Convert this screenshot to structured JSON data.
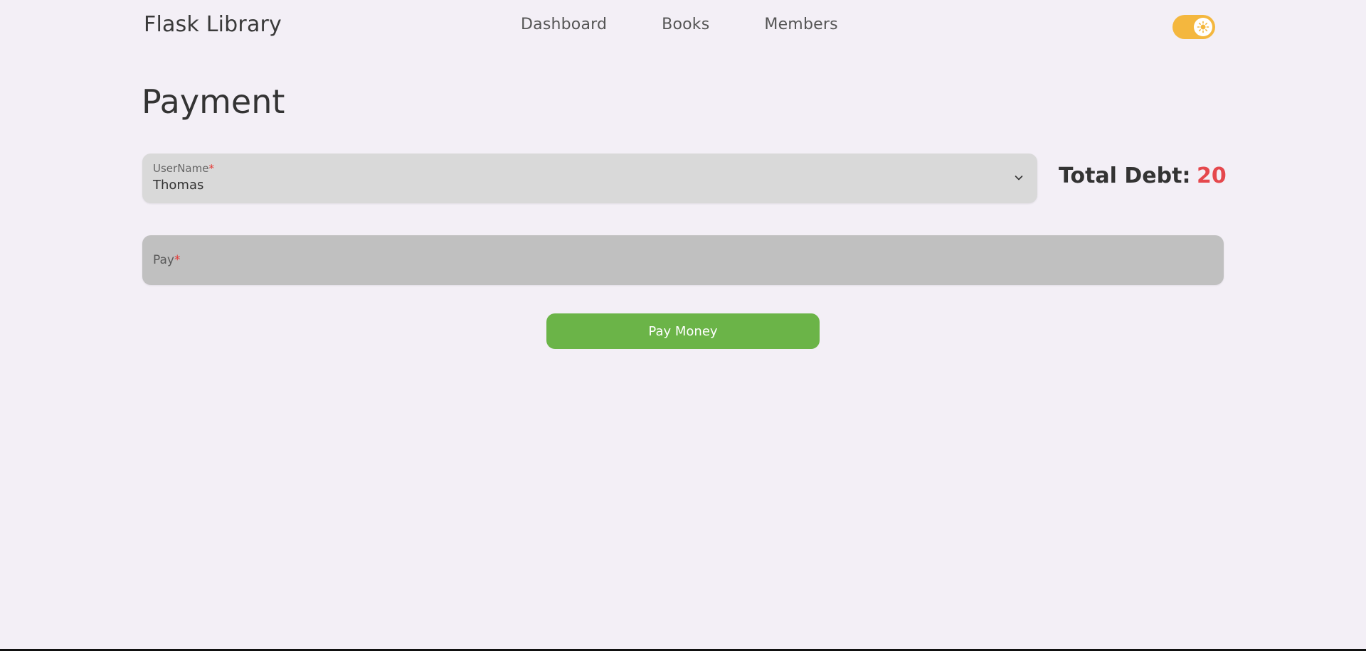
{
  "header": {
    "brand": "Flask Library",
    "nav": [
      "Dashboard",
      "Books",
      "Members"
    ],
    "theme_toggle_icon": "sun-icon",
    "theme_toggle_color": "#f4b73e"
  },
  "main": {
    "title": "Payment",
    "username_field": {
      "label": "UserName",
      "required_mark": "*",
      "value": "Thomas"
    },
    "total_debt": {
      "label": "Total Debt:",
      "value": "20",
      "value_color": "#e5484d"
    },
    "pay_field": {
      "label": "Pay",
      "required_mark": "*",
      "value": ""
    },
    "pay_button": {
      "label": "Pay Money",
      "color": "#6bb448"
    }
  }
}
